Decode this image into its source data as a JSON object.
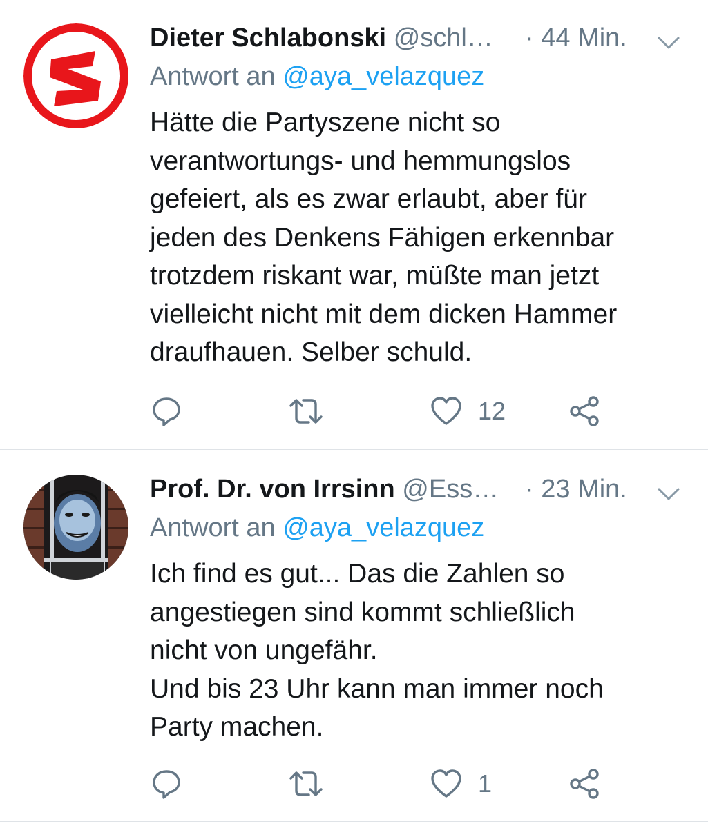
{
  "tweets": [
    {
      "display_name": "Dieter Schlabonski",
      "handle": "@schl…",
      "separator": "·",
      "time": "44 Min.",
      "reply_prefix": "Antwort an",
      "reply_mention": "@aya_velazquez",
      "text": "Hätte die Partyszene nicht so\nverantwortungs- und hemmungslos\ngefeiert, als es zwar erlaubt, aber für\njeden des Denkens Fähigen erkennbar\ntrotzdem riskant war, müßte man jetzt\nvielleicht nicht mit dem dicken Hammer\ndraufhauen. Selber schuld.",
      "reply_count": "",
      "retweet_count": "",
      "like_count": "12",
      "avatar_icon": "red-s-logo-icon"
    },
    {
      "display_name": "Prof. Dr. von Irrsinn",
      "handle": "@Ess…",
      "separator": "·",
      "time": "23 Min.",
      "reply_prefix": "Antwort an",
      "reply_mention": "@aya_velazquez",
      "text": "Ich find es gut...  Das die Zahlen so\nangestiegen sind kommt schließlich\nnicht von ungefähr.\nUnd bis 23 Uhr kann man immer noch\nParty machen.",
      "reply_count": "",
      "retweet_count": "",
      "like_count": "1",
      "avatar_icon": "portrait-photo-icon"
    }
  ],
  "colors": {
    "name": "#14171a",
    "secondary": "#657786",
    "mention": "#1da1f2",
    "icon": "#657786",
    "divider": "#dfe3e7",
    "logo_red": "#e8161b"
  },
  "icons": {
    "caret": "chevron-down-icon",
    "reply": "reply-bubble-icon",
    "retweet": "retweet-icon",
    "like": "heart-icon",
    "share": "share-icon"
  }
}
